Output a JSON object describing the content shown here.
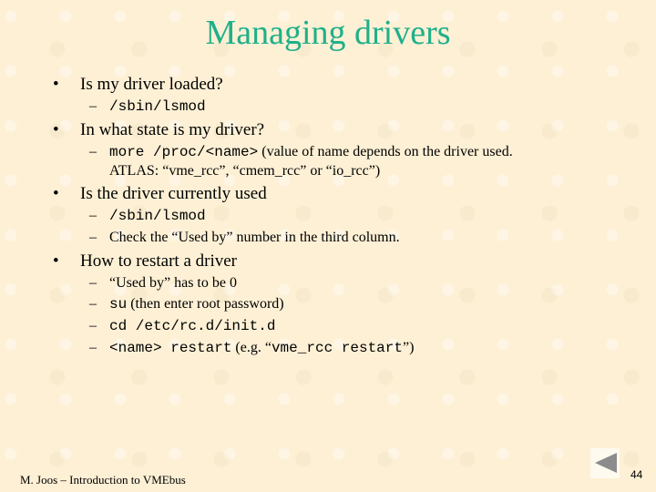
{
  "title": "Managing drivers",
  "bullets": [
    {
      "text": "Is my driver loaded?",
      "subs": [
        {
          "mono": "/sbin/lsmod",
          "text": ""
        }
      ]
    },
    {
      "text": "In what state is my driver?",
      "subs": [
        {
          "mono": "more /proc/<name>",
          "text": " (value of name depends on the driver used.",
          "line2": "ATLAS: “vme_rcc”, “cmem_rcc” or “io_rcc”)"
        }
      ]
    },
    {
      "text": "Is the driver currently used",
      "subs": [
        {
          "mono": "/sbin/lsmod",
          "text": ""
        },
        {
          "mono": "",
          "text": "Check the “Used by” number in the third column."
        }
      ]
    },
    {
      "text": "How to restart a driver",
      "subs": [
        {
          "mono": "",
          "text": "“Used by” has to be 0"
        },
        {
          "mono": "su",
          "text": " (then enter root password)"
        },
        {
          "mono": "cd /etc/rc.d/init.d",
          "text": ""
        },
        {
          "mono": "<name> restart",
          "text": " (e.g. “",
          "mono2": "vme_rcc restart",
          "text2": "”)"
        }
      ]
    }
  ],
  "footer": {
    "left": "M. Joos – Introduction to VMEbus",
    "page_number": "44",
    "nav_icon": "previous-slide-icon"
  },
  "colors": {
    "title": "#1fb08a",
    "background": "#fdf0d5"
  }
}
